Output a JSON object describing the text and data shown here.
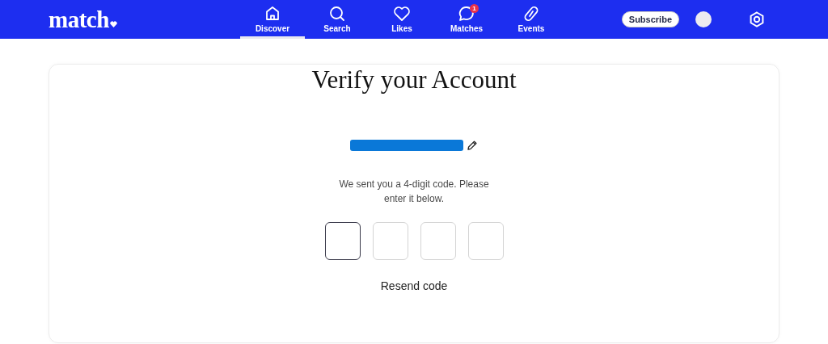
{
  "brand": {
    "logo": "match"
  },
  "nav": [
    {
      "label": "Discover",
      "kind": "home",
      "selected": true
    },
    {
      "label": "Search",
      "kind": "search",
      "selected": false
    },
    {
      "label": "Likes",
      "kind": "heart",
      "selected": false
    },
    {
      "label": "Matches",
      "kind": "chat",
      "selected": false,
      "badge": "1"
    },
    {
      "label": "Events",
      "kind": "tag",
      "selected": false
    }
  ],
  "subscribe_button": "Subscribe",
  "title": "Verify your Account",
  "phone": {
    "redacted": true
  },
  "message": "We sent you a 4-digit code. Please enter it below.",
  "code_boxes": [
    {
      "focused": true
    },
    {
      "focused": false
    },
    {
      "focused": false
    },
    {
      "focused": false
    }
  ],
  "resend_link": "Resend code"
}
